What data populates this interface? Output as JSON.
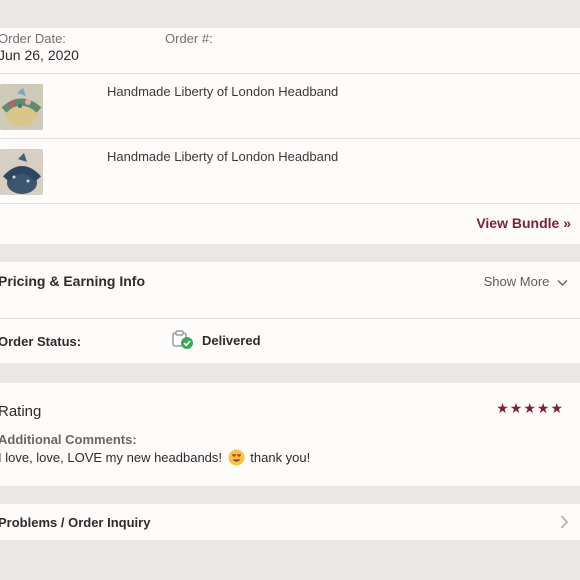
{
  "order": {
    "date_label": "Order Date:",
    "date_value": "Jun 26, 2020",
    "number_label": "Order #:"
  },
  "items": [
    {
      "title": "Handmade Liberty of London Headband"
    },
    {
      "title": "Handmade Liberty of London Headband"
    }
  ],
  "bundle_link": "View Bundle »",
  "pricing": {
    "title": "Pricing & Earning Info",
    "show_more": "Show More"
  },
  "status": {
    "label": "Order Status:",
    "value": "Delivered"
  },
  "rating": {
    "title": "Rating",
    "stars": "★★★★★",
    "stars_count": 5,
    "comments_label": "Additional Comments:",
    "comment_before": "I love, love, LOVE my new headbands!",
    "comment_after": "thank you!"
  },
  "inquiry": {
    "label": "Problems / Order Inquiry"
  },
  "colors": {
    "accent": "#7a2338",
    "delivered_green": "#3aa75a",
    "background": "#e9e8e4"
  }
}
